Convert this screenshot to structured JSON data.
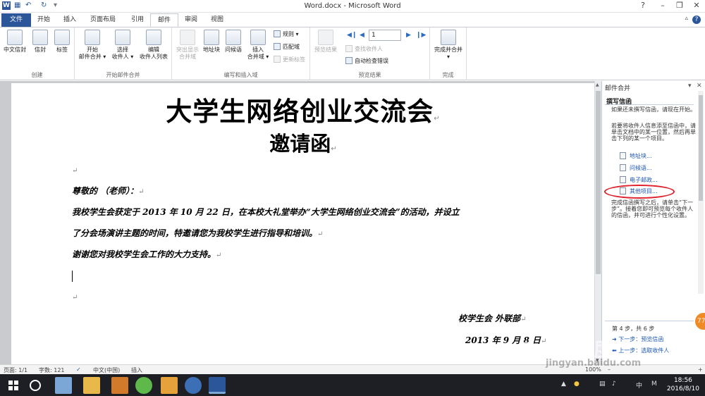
{
  "window": {
    "title": "Word.docx - Microsoft Word",
    "app_icon": "W",
    "qat_icons": [
      "save-icon",
      "undo-icon",
      "redo-icon",
      "customize-icon"
    ],
    "minimize": "–",
    "restore": "❐",
    "close": "✕"
  },
  "tabs": [
    "文件",
    "开始",
    "插入",
    "页面布局",
    "引用",
    "邮件",
    "审阅",
    "视图"
  ],
  "active_tab": "邮件",
  "ribbon": {
    "create": {
      "label": "创建",
      "buttons": [
        "中文信封",
        "信封",
        "标签"
      ]
    },
    "start_merge": {
      "label": "开始邮件合并",
      "buttons": [
        {
          "line1": "开始",
          "line2": "邮件合并 ▾"
        },
        {
          "line1": "选择",
          "line2": "收件人 ▾"
        },
        {
          "line1": "编辑",
          "line2": "收件人列表"
        }
      ]
    },
    "write_insert": {
      "label": "编写和插入域",
      "buttons": [
        {
          "line1": "突出显示",
          "line2": "合并域"
        },
        {
          "line1": "地址块",
          "line2": ""
        },
        {
          "line1": "问候语",
          "line2": ""
        },
        {
          "line1": "插入",
          "line2": "合并域 ▾"
        }
      ],
      "small": [
        "规则 ▾",
        "匹配域",
        "更新标签"
      ]
    },
    "preview": {
      "label": "预览结果",
      "button": "预览结果",
      "record": "1",
      "small": [
        "查找收件人",
        "自动检查错误"
      ]
    },
    "finish": {
      "label": "完成",
      "button": "完成并合并",
      "arrow": "▾"
    }
  },
  "document": {
    "title": "大学生网络创业交流会",
    "subtitle": "邀请函",
    "salutation": "尊敬的              （老师）：",
    "body1": "我校学生会获定于 2013 年 10 月 22 日，在本校大礼堂举办“大学生网络创业交流会”的活动，并设立",
    "body2": "了分会场演讲主题的时间，特邀请您为我校学生进行指导和培训。",
    "body3": "谢谢您对我校学生会工作的大力支持。",
    "signature": "校学生会  外联部",
    "date": "2013 年  9 月  8 日",
    "para_mark": "↵"
  },
  "pane": {
    "title": "邮件合并",
    "menu_arrow": "▾",
    "close": "✕",
    "section": "撰写信函",
    "text1": "如果还未撰写信函，请现在开始。",
    "text2": "若要将收件人信息添至信函中，请单击文档中的某一位置，然后再单击下列的某一个项目。",
    "links": [
      "地址块...",
      "问候语...",
      "电子邮政...",
      "其他项目..."
    ],
    "text3": "完成信函撰写之后，请单击“下一步”。接着您即可预览每个收件人的信函，并可进行个性化设置。",
    "step": "第 4 步，共 6 步",
    "next": "下一步：预览信函",
    "prev": "上一步：选取收件人",
    "badge": "77"
  },
  "status": {
    "page": "页面: 1/1",
    "words": "字数: 121",
    "lang": "中文(中国)",
    "mode": "插入",
    "zoom": "100%",
    "zoom_minus": "–",
    "zoom_plus": "+"
  },
  "taskbar": {
    "apps": [
      "start-icon",
      "search-icon",
      "fan-icon",
      "folder-icon",
      "package-icon",
      "browser-icon",
      "paint-icon",
      "globe-icon",
      "word-icon"
    ],
    "tray": [
      "中",
      "M"
    ],
    "time": "18:56",
    "date": "2016/8/10"
  },
  "watermark": {
    "brand": "Bai●百度",
    "url": "jingyan.baidu.com"
  },
  "colors": {
    "accent": "#2b579a",
    "link": "#1d56b5",
    "highlight_circle": "#e0202a",
    "taskbar": "#1d1f25"
  }
}
